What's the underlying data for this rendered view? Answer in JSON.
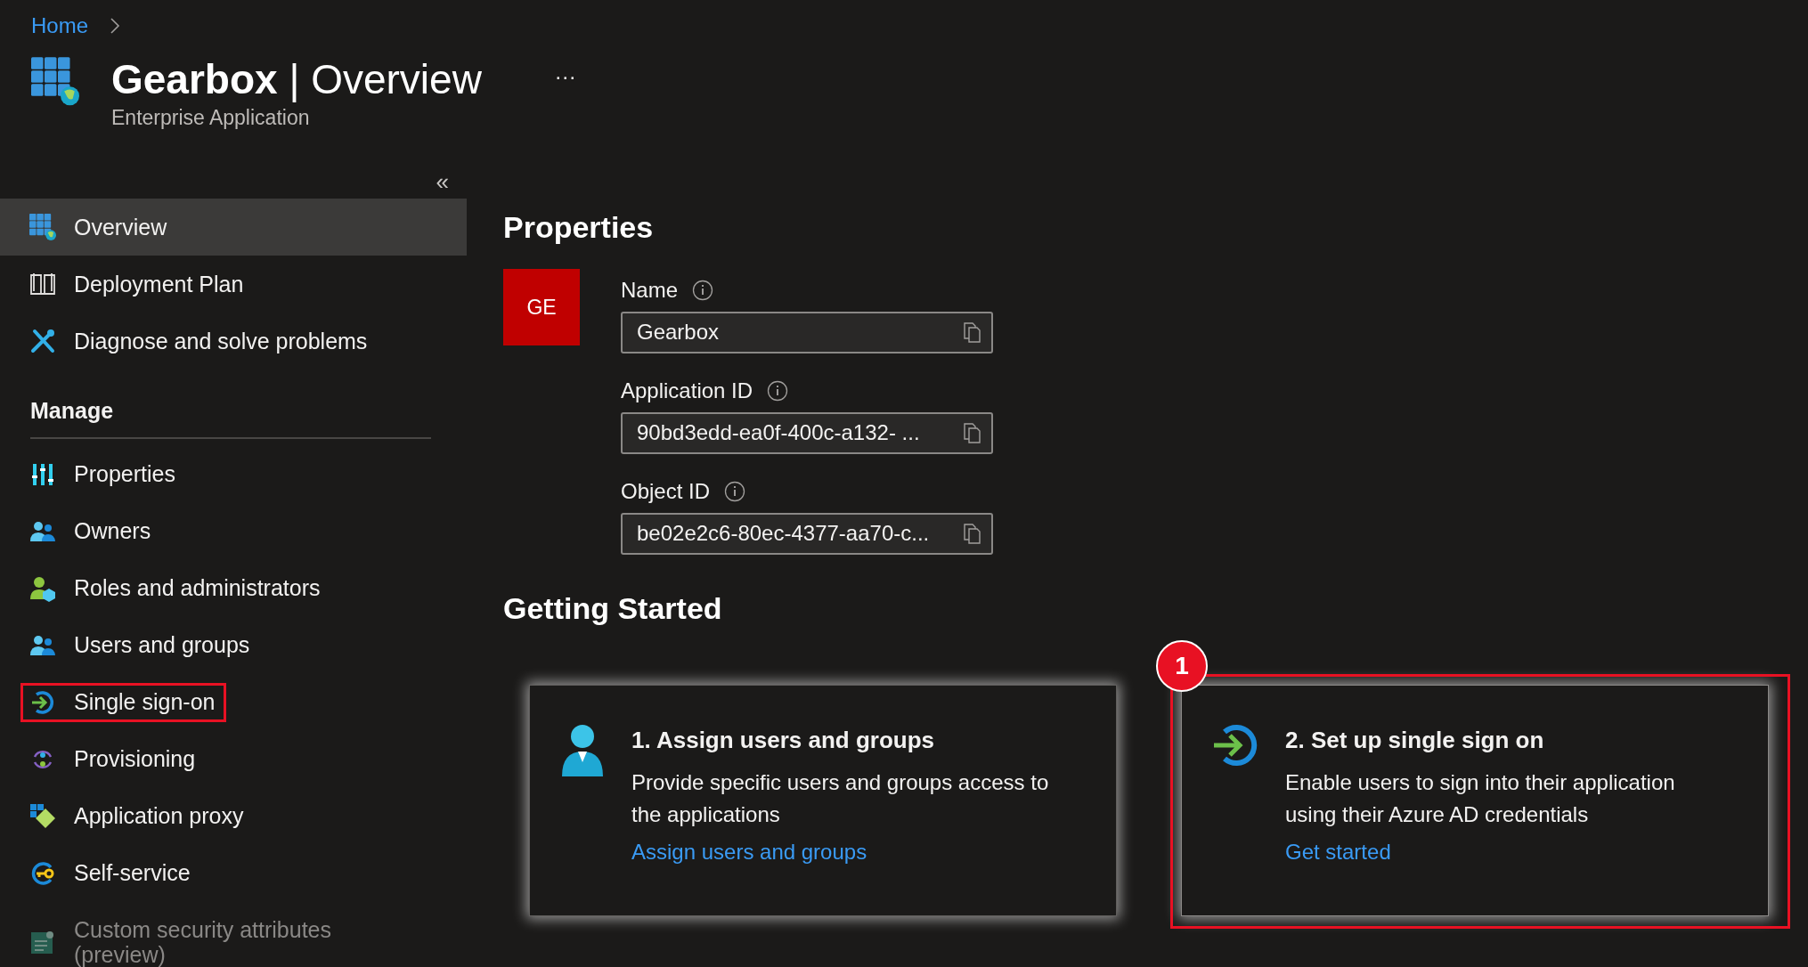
{
  "breadcrumb": [
    {
      "label": "Home"
    }
  ],
  "header": {
    "title": "**Gearbox** | Overview",
    "subtitle": "Enterprise Application",
    "more": "···"
  },
  "sidebar": {
    "collapse": "«",
    "items": [
      {
        "label": "Overview",
        "selected": true,
        "highlighted": false,
        "disabled": false
      },
      {
        "label": "Deployment Plan",
        "selected": false,
        "highlighted": false,
        "disabled": false
      },
      {
        "label": "Diagnose and solve problems",
        "selected": false,
        "highlighted": false,
        "disabled": false
      }
    ],
    "sections": [
      {
        "title": "Manage",
        "items": [
          {
            "label": "Properties",
            "selected": false,
            "highlighted": false,
            "disabled": false
          },
          {
            "label": "Owners",
            "selected": false,
            "highlighted": false,
            "disabled": false
          },
          {
            "label": "Roles and administrators",
            "selected": false,
            "highlighted": false,
            "disabled": false
          },
          {
            "label": "Users and groups",
            "selected": false,
            "highlighted": false,
            "disabled": false
          },
          {
            "label": "Single sign-on",
            "selected": false,
            "highlighted": true,
            "disabled": false
          },
          {
            "label": "Provisioning",
            "selected": false,
            "highlighted": false,
            "disabled": false
          },
          {
            "label": "Application proxy",
            "selected": false,
            "highlighted": false,
            "disabled": false
          },
          {
            "label": "Self-service",
            "selected": false,
            "highlighted": false,
            "disabled": false
          },
          {
            "label": "Custom security attributes (preview)",
            "selected": false,
            "highlighted": false,
            "disabled": true
          }
        ]
      }
    ]
  },
  "properties": {
    "heading": "Properties",
    "avatar": "GE",
    "fields": [
      {
        "label": "Name",
        "value": "Gearbox"
      },
      {
        "label": "Application ID",
        "value": "90bd3edd-ea0f-400c-a132- ..."
      },
      {
        "label": "Object ID",
        "value": "be02e2c6-80ec-4377-aa70-c..."
      }
    ]
  },
  "getting_started": {
    "heading": "Getting Started",
    "cards": [
      {
        "title": "1. Assign users and groups",
        "description": "Provide specific users and groups access to the applications",
        "link": "Assign users and groups",
        "highlighted": false
      },
      {
        "title": "2. Set up single sign on",
        "description": "Enable users to sign into their application using their Azure AD credentials",
        "link": "Get started",
        "highlighted": true,
        "badge": "1"
      }
    ]
  }
}
